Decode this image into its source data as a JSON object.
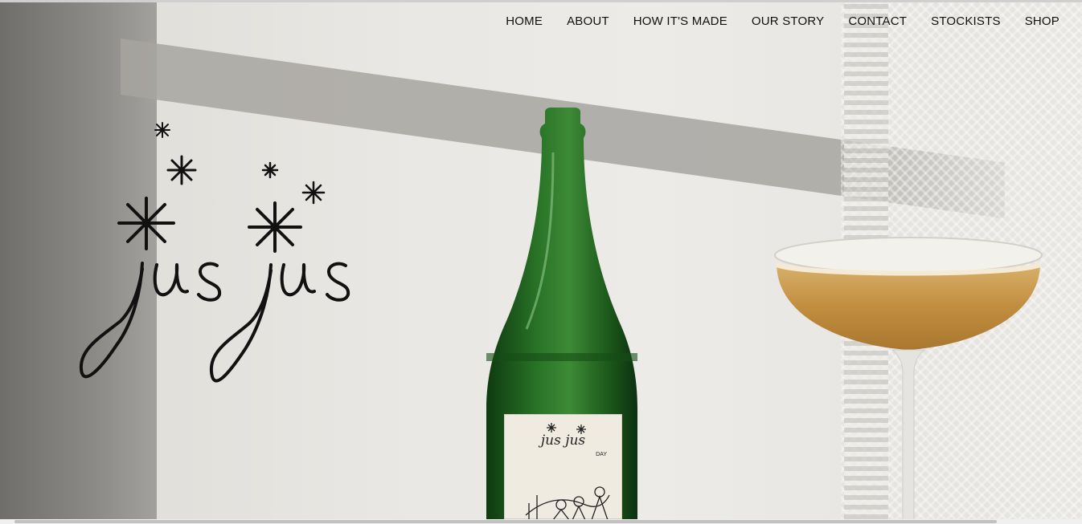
{
  "nav": {
    "items": [
      {
        "label": "HOME"
      },
      {
        "label": "ABOUT"
      },
      {
        "label": "HOW IT'S MADE"
      },
      {
        "label": "OUR STORY"
      },
      {
        "label": "CONTACT"
      },
      {
        "label": "STOCKISTS"
      },
      {
        "label": "SHOP"
      }
    ]
  },
  "logo": {
    "text": "jus jus"
  },
  "bottle_label": {
    "brand": "jus jus",
    "variant": "DAY"
  },
  "colors": {
    "nav_text": "#111111",
    "bottle_green": "#1f5a1c",
    "drink_amber": "#c99a4f",
    "wall": "#e9e7e3"
  },
  "icons": {
    "logo_stars": "asterisk-sparkle-icons"
  }
}
